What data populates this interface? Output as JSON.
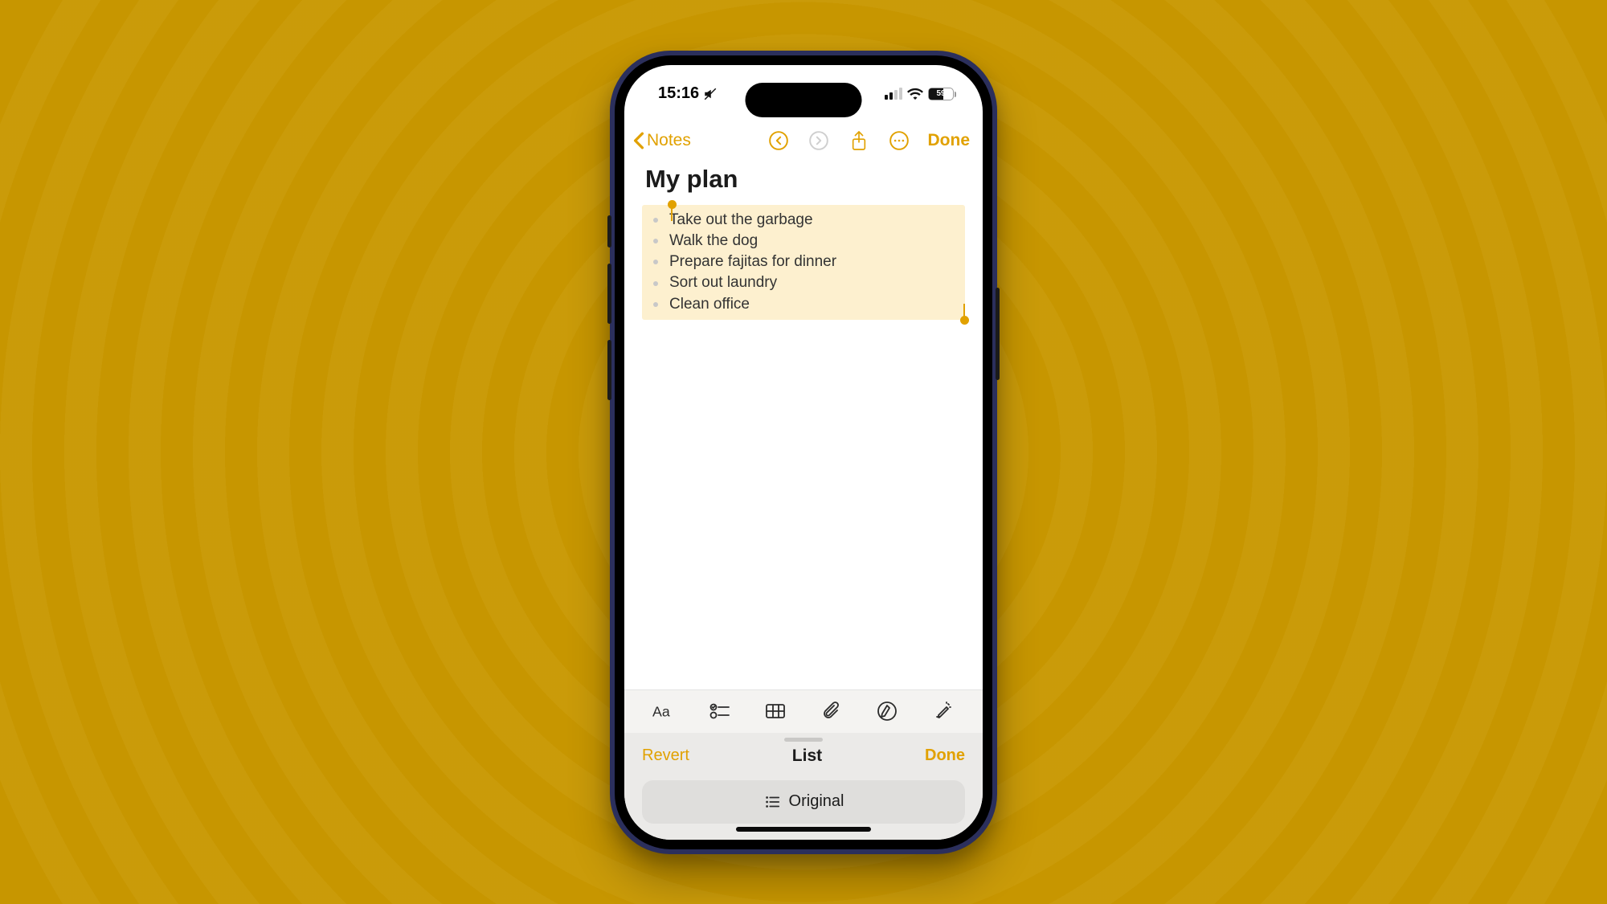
{
  "status": {
    "time": "15:16",
    "silent": true,
    "signal_bars_active": 2,
    "wifi_bars": 3,
    "battery_percent": "59"
  },
  "nav": {
    "back_label": "Notes",
    "undo_enabled": true,
    "redo_enabled": false,
    "done_label": "Done"
  },
  "note": {
    "title": "My plan",
    "items": [
      "Take out the garbage",
      "Walk the dog",
      "Prepare fajitas for dinner",
      "Sort out laundry",
      "Clean office"
    ],
    "selection_highlighted": true
  },
  "format_toolbar": {
    "icons": [
      "text-style",
      "checklist",
      "table",
      "attachment",
      "markup",
      "writing-tools"
    ]
  },
  "panel": {
    "left_label": "Revert",
    "title": "List",
    "right_label": "Done",
    "button_label": "Original"
  },
  "colors": {
    "accent": "#e1a100",
    "selection": "#fdf0cf",
    "panel_bg": "#ebeae8",
    "button_bg": "#dfdedc"
  }
}
